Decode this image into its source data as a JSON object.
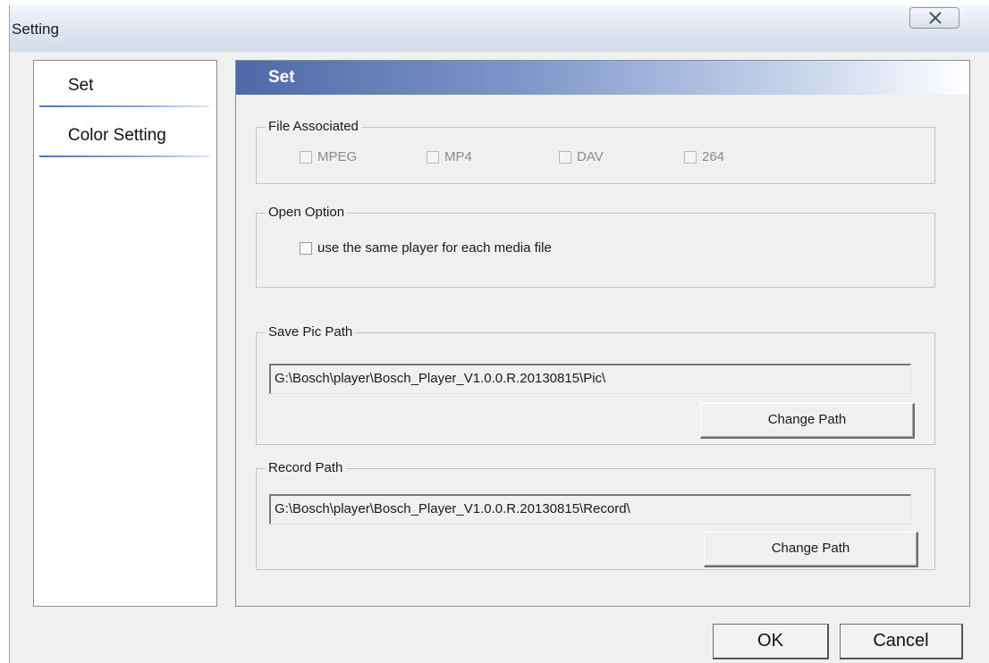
{
  "window": {
    "title": "Setting",
    "close_icon": "close-icon"
  },
  "sidebar": {
    "items": [
      {
        "label": "Set"
      },
      {
        "label": "Color Setting"
      }
    ]
  },
  "panel": {
    "header": "Set",
    "file_associated": {
      "legend": "File Associated",
      "options": [
        {
          "label": "MPEG",
          "checked": false,
          "enabled": false
        },
        {
          "label": "MP4",
          "checked": false,
          "enabled": false
        },
        {
          "label": "DAV",
          "checked": false,
          "enabled": false
        },
        {
          "label": "264",
          "checked": false,
          "enabled": false
        }
      ]
    },
    "open_option": {
      "legend": "Open Option",
      "checkbox_label": "use the same player for each media file",
      "checked": false
    },
    "save_pic_path": {
      "legend": "Save Pic Path",
      "value": "G:\\Bosch\\player\\Bosch_Player_V1.0.0.R.20130815\\Pic\\",
      "button_label": "Change Path"
    },
    "record_path": {
      "legend": "Record Path",
      "value": "G:\\Bosch\\player\\Bosch_Player_V1.0.0.R.20130815\\Record\\",
      "button_label": "Change Path"
    }
  },
  "footer": {
    "ok_label": "OK",
    "cancel_label": "Cancel"
  },
  "colors": {
    "header_gradient_start": "#4d69a8",
    "sidebar_underline": "#4f73b8",
    "dialog_background": "#f0f0f0"
  }
}
